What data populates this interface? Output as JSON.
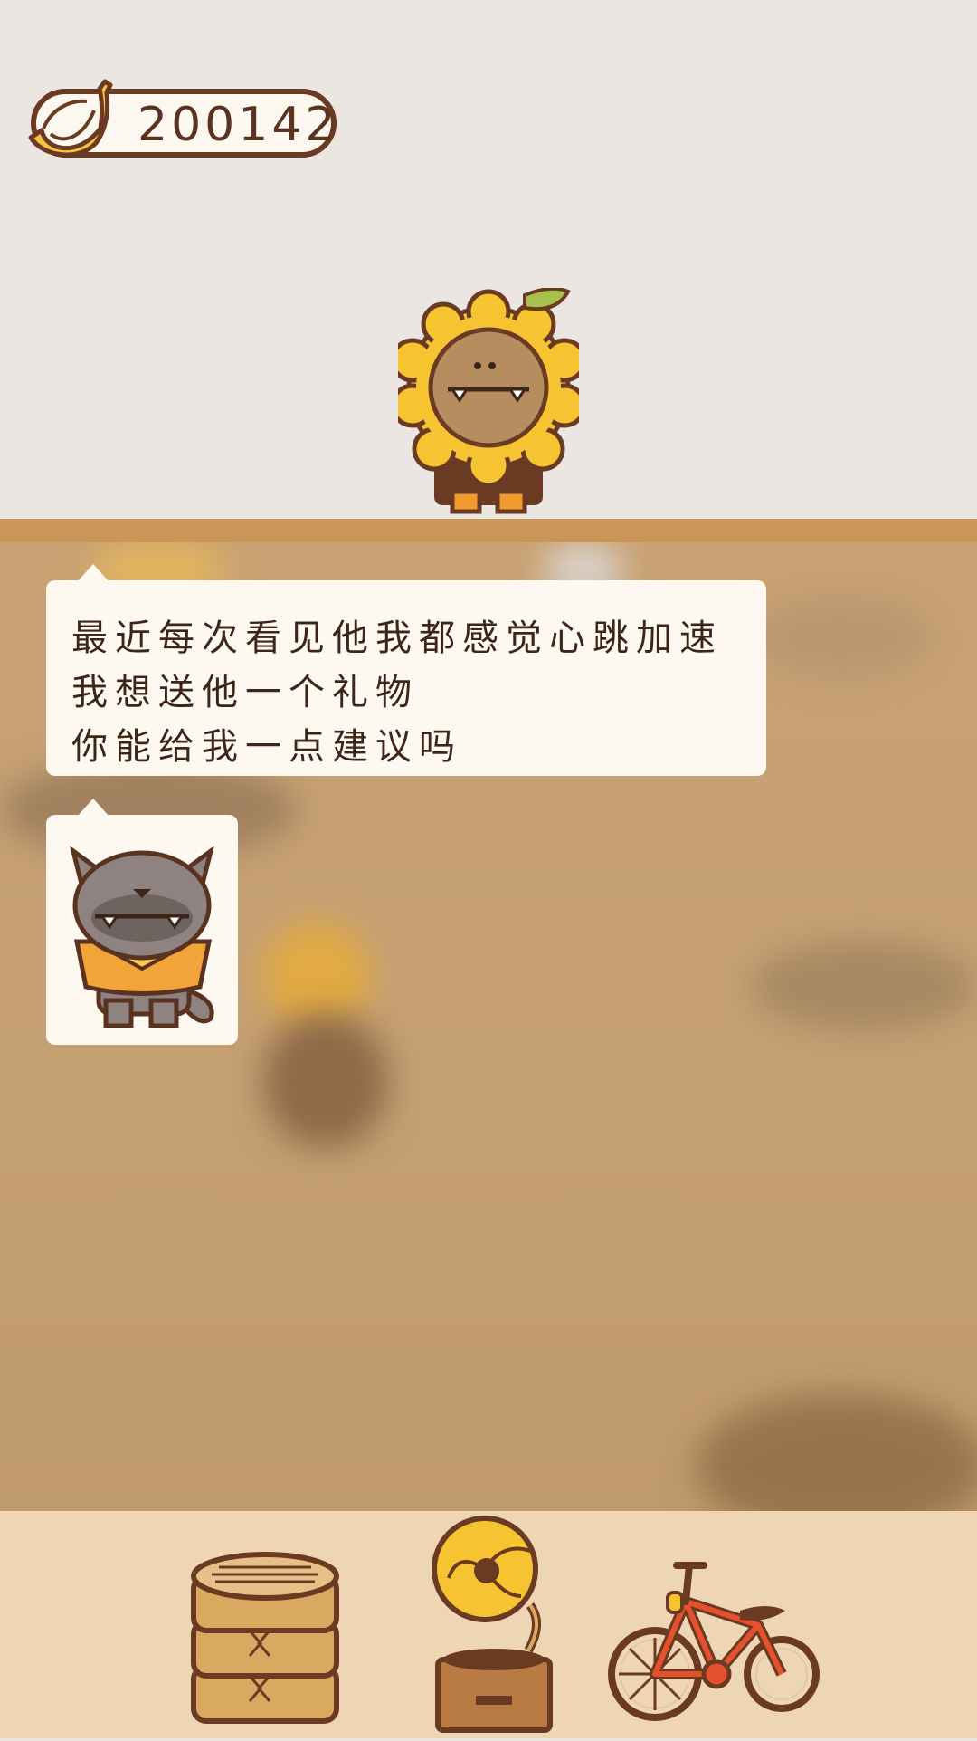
{
  "currency": {
    "icon": "banana-icon",
    "value": "200142"
  },
  "speaker": {
    "name_icon": "sunflower-character"
  },
  "dialog": {
    "lines": [
      "最近每次看见他我都感觉心跳加速",
      "我想送他一个礼物",
      "你能给我一点建议吗"
    ]
  },
  "target": {
    "icon": "raccoon-character"
  },
  "gifts": [
    {
      "icon": "steamer-basket-icon"
    },
    {
      "icon": "gramophone-icon"
    },
    {
      "icon": "bicycle-icon"
    }
  ],
  "colors": {
    "top_bg": "#ebe6e2",
    "room": "#c5a073",
    "shelf": "#c99658",
    "bottom_bar": "#eed6b5",
    "bubble": "#fdf9f0",
    "outline": "#6b3a22"
  }
}
